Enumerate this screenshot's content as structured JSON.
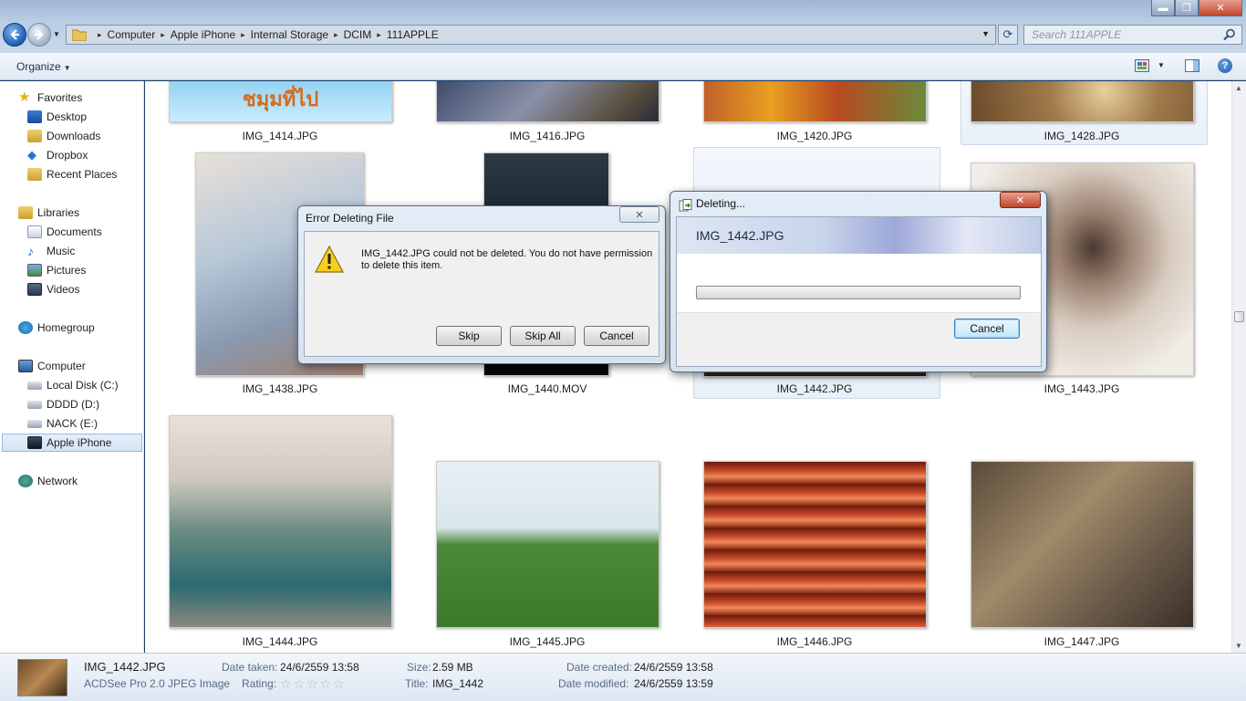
{
  "address": {
    "crumbs": [
      "Computer",
      "Apple iPhone",
      "Internal Storage",
      "DCIM",
      "111APPLE"
    ]
  },
  "search": {
    "placeholder": "Search 111APPLE"
  },
  "window_controls": {
    "minimize": "▬",
    "maximize": "❐",
    "close": "✕"
  },
  "toolbar": {
    "organize": "Organize",
    "help": "?"
  },
  "nav": {
    "favorites": "Favorites",
    "desktop": "Desktop",
    "downloads": "Downloads",
    "dropbox": "Dropbox",
    "recent": "Recent Places",
    "libraries": "Libraries",
    "documents": "Documents",
    "music": "Music",
    "pictures": "Pictures",
    "videos": "Videos",
    "homegroup": "Homegroup",
    "computer": "Computer",
    "local_c": "Local Disk (C:)",
    "dddd": "DDDD (D:)",
    "nack": "NACK (E:)",
    "iphone": "Apple iPhone",
    "network": "Network"
  },
  "files": {
    "f1414": "IMG_1414.JPG",
    "f1416": "IMG_1416.JPG",
    "f1420": "IMG_1420.JPG",
    "f1428": "IMG_1428.JPG",
    "f1438": "IMG_1438.JPG",
    "f1440": "IMG_1440.MOV",
    "f1442": "IMG_1442.JPG",
    "f1443": "IMG_1443.JPG",
    "f1444": "IMG_1444.JPG",
    "f1445": "IMG_1445.JPG",
    "f1446": "IMG_1446.JPG",
    "f1447": "IMG_1447.JPG"
  },
  "thumb_1414_text": "ชมุมที่ไป",
  "details": {
    "name": "IMG_1442.JPG",
    "type": "ACDSee Pro 2.0 JPEG Image",
    "date_taken_label": "Date taken:",
    "date_taken": "24/6/2559 13:58",
    "rating_label": "Rating:",
    "rating_stars": "☆☆☆☆☆",
    "size_label": "Size:",
    "size": "2.59 MB",
    "title_label": "Title:",
    "title": "IMG_1442",
    "created_label": "Date created:",
    "created": "24/6/2559 13:58",
    "modified_label": "Date modified:",
    "modified": "24/6/2559 13:59"
  },
  "error_dialog": {
    "title": "Error Deleting File",
    "message": "IMG_1442.JPG could not be deleted. You do not have permission to delete this item.",
    "skip": "Skip",
    "skip_all": "Skip All",
    "cancel": "Cancel"
  },
  "deleting_dialog": {
    "title": "Deleting...",
    "filename": "IMG_1442.JPG",
    "cancel": "Cancel",
    "progress": 0
  },
  "colors": {
    "accent": "#1d5db8",
    "selection": "#d5e4f5"
  }
}
